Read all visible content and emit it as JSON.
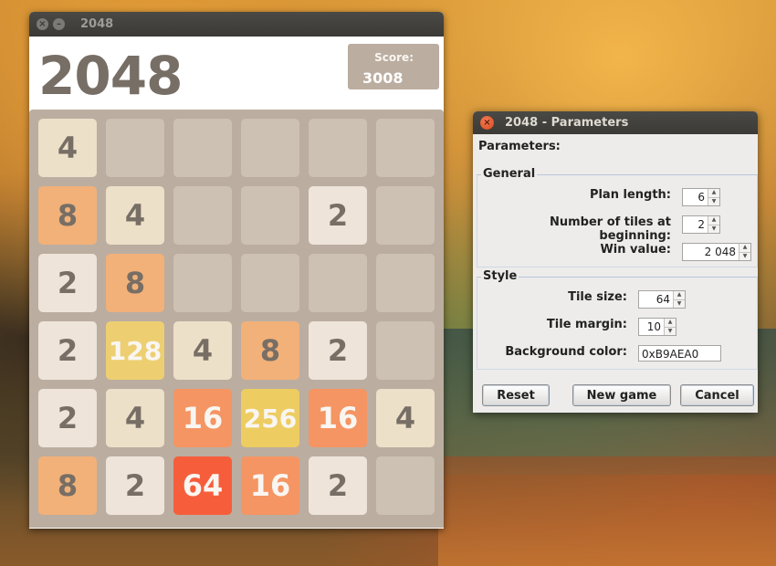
{
  "main_window": {
    "title": "2048",
    "close_icon": "×",
    "minimize_icon": "–",
    "game_title": "2048",
    "score_label": "Score:",
    "score_value": "3008",
    "board": [
      [
        "4",
        "",
        "",
        "",
        "",
        ""
      ],
      [
        "8",
        "4",
        "",
        "",
        "2",
        ""
      ],
      [
        "2",
        "8",
        "",
        "",
        "",
        ""
      ],
      [
        "2",
        "128",
        "4",
        "8",
        "2",
        ""
      ],
      [
        "2",
        "4",
        "16",
        "256",
        "16",
        "4"
      ],
      [
        "8",
        "2",
        "64",
        "16",
        "2",
        ""
      ]
    ]
  },
  "dialog": {
    "title": "2048 - Parameters",
    "close_icon": "×",
    "parameters_label": "Parameters:",
    "general": {
      "title": "General",
      "plan_length_label": "Plan length:",
      "plan_length_value": "6",
      "tiles_beginning_label": "Number of tiles at beginning:",
      "tiles_beginning_value": "2",
      "win_value_label": "Win value:",
      "win_value_value": "2 048"
    },
    "style": {
      "title": "Style",
      "tile_size_label": "Tile size:",
      "tile_size_value": "64",
      "tile_margin_label": "Tile margin:",
      "tile_margin_value": "10",
      "background_color_label": "Background color:",
      "background_color_value": "0xB9AEA0"
    },
    "buttons": {
      "reset": "Reset",
      "new_game": "New game",
      "cancel": "Cancel"
    }
  }
}
